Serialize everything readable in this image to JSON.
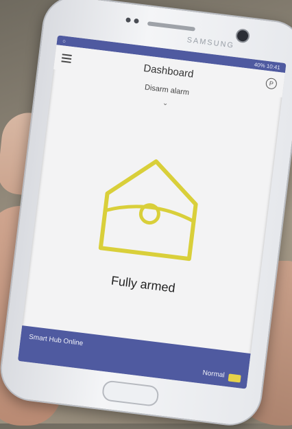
{
  "phone": {
    "brand": "SAMSUNG"
  },
  "status_bar": {
    "right_text": "40% 10:41"
  },
  "app": {
    "title": "Dashboard",
    "alarm_action": "Disarm alarm",
    "arm_status": "Fully armed",
    "hub_status": "Smart Hub Online",
    "mode_label": "Normal"
  },
  "colors": {
    "accent": "#4f5aa0",
    "house_icon": "#d9cf3a"
  }
}
